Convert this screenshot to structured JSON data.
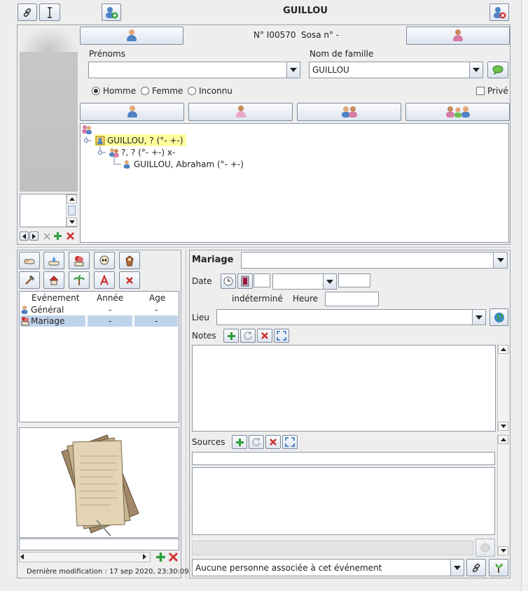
{
  "header": {
    "title": "GUILLOU"
  },
  "identity": {
    "number_label": "N° I00570",
    "sosa_label": "Sosa n° -"
  },
  "fields": {
    "prenoms_label": "Prénoms",
    "prenoms_value": "",
    "nom_label": "Nom de famille",
    "nom_value": "GUILLOU"
  },
  "sex": {
    "homme": "Homme",
    "femme": "Femme",
    "inconnu": "Inconnu",
    "prive": "Privé"
  },
  "tree": {
    "root": "GUILLOU, ? (°- +-)",
    "family": "?, ? (°- +-) x-",
    "child": "GUILLOU, Abraham (°- +-)"
  },
  "events_table": {
    "headers": [
      "Evénement",
      "Année",
      "Age"
    ],
    "rows": [
      {
        "event": "Général",
        "year": "-",
        "age": "-"
      },
      {
        "event": "Mariage",
        "year": "-",
        "age": "-"
      }
    ]
  },
  "footer": {
    "last_modified": "Dernière modification : 17 sep 2020, 23:30:09"
  },
  "event_panel": {
    "type": "Mariage",
    "date_label": "Date",
    "indetermine": "indéterminé",
    "heure_label": "Heure",
    "lieu_label": "Lieu",
    "notes_label": "Notes",
    "sources_label": "Sources",
    "assoc_value": "Aucune personne associée à cet événement"
  },
  "colors": {
    "accent": "#bfd3ea",
    "highlight": "#ffff9e",
    "male": "#4f82c4",
    "female": "#d67aa6"
  }
}
